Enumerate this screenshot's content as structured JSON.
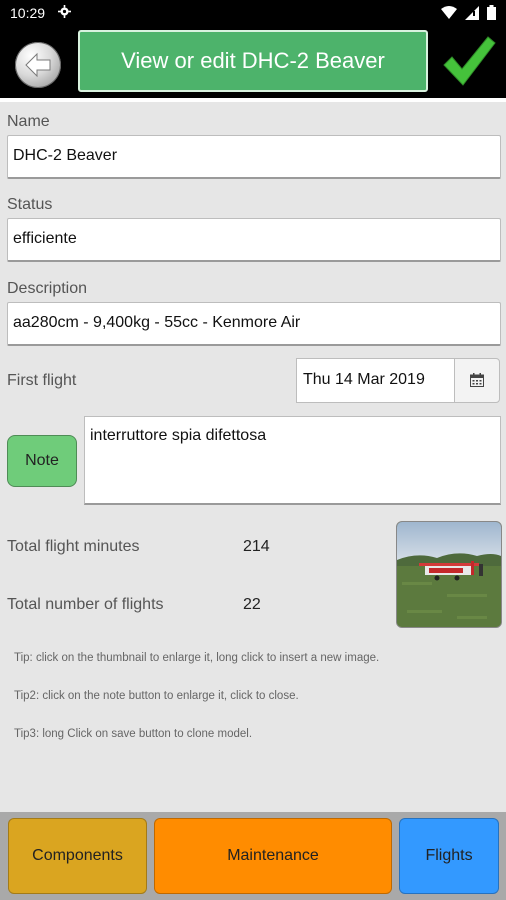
{
  "status_bar": {
    "time": "10:29"
  },
  "header": {
    "title": "View or edit DHC-2 Beaver"
  },
  "form": {
    "name_label": "Name",
    "name_value": "DHC-2 Beaver",
    "status_label": "Status",
    "status_value": "efficiente",
    "description_label": "Description",
    "description_value": "aa280cm - 9,400kg - 55cc - Kenmore Air",
    "first_flight_label": "First flight",
    "first_flight_value": "Thu 14 Mar 2019",
    "note_button": "Note",
    "note_value": "interruttore spia difettosa"
  },
  "stats": {
    "minutes_label": "Total flight minutes",
    "minutes_value": "214",
    "flights_label": "Total number of flights",
    "flights_value": "22"
  },
  "tips": [
    "Tip: click on the thumbnail to enlarge it, long click to insert a new image.",
    "Tip2: click on the note button to enlarge it, click to close.",
    "Tip3: long Click on save button to clone model."
  ],
  "bottom": {
    "components": "Components",
    "maintenance": "Maintenance",
    "flights": "Flights"
  },
  "colors": {
    "title_green": "#4db36b",
    "components": "#daa520",
    "maintenance": "#ff8c00",
    "flights": "#3399ff",
    "note_green": "#6fcc7a"
  }
}
